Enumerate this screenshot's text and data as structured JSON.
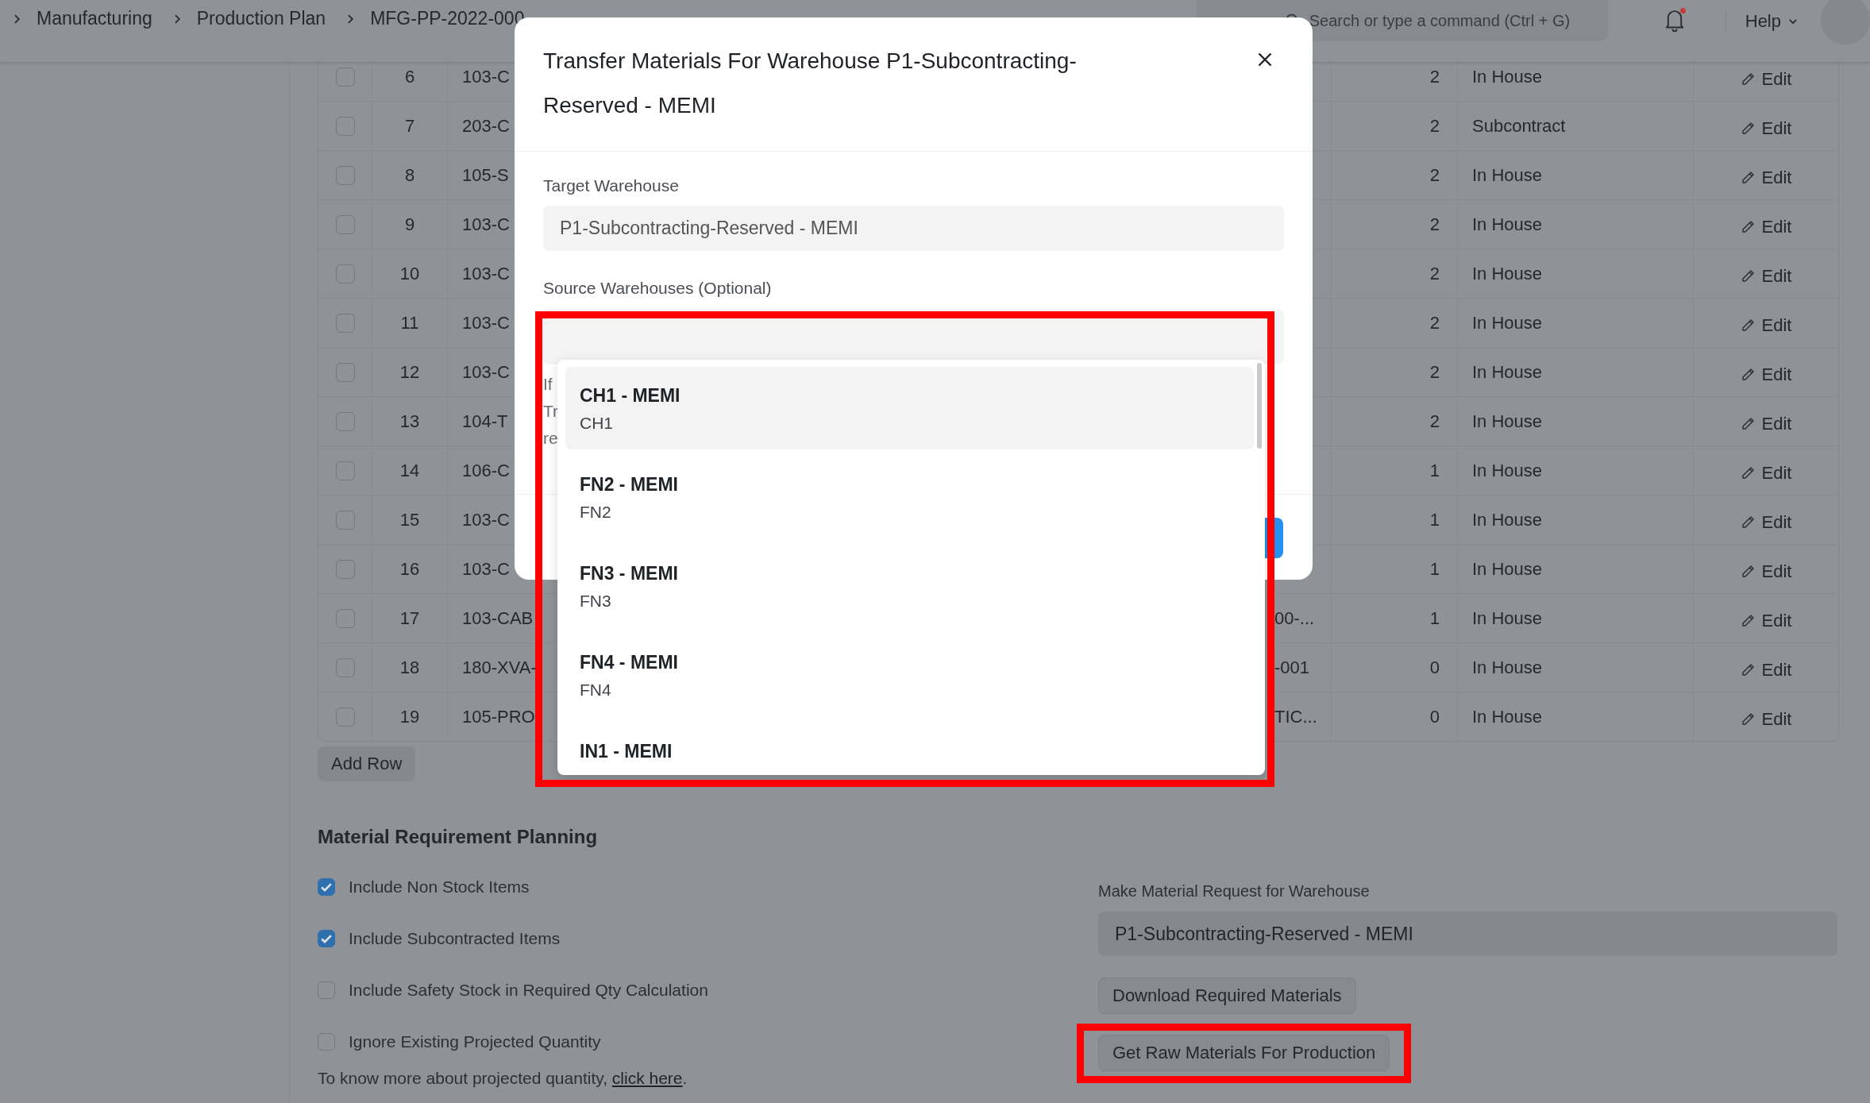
{
  "breadcrumbs": [
    {
      "label": "Manufacturing"
    },
    {
      "label": "Production Plan"
    },
    {
      "label": "MFG-PP-2022-000"
    }
  ],
  "search": {
    "placeholder": "Search or type a command (Ctrl + G)"
  },
  "notifications": {
    "unread": true
  },
  "help_menu": {
    "label": "Help"
  },
  "table": {
    "rows": [
      {
        "selected": false,
        "no": "6",
        "column_3": "103-C",
        "qty": "2",
        "type": "In House",
        "action": "Edit"
      },
      {
        "selected": false,
        "no": "7",
        "column_3": "203-C",
        "qty": "2",
        "type": "Subcontract",
        "action": "Edit"
      },
      {
        "selected": false,
        "no": "8",
        "column_3": "105-S",
        "qty": "2",
        "type": "In House",
        "action": "Edit"
      },
      {
        "selected": false,
        "no": "9",
        "column_3": "103-C",
        "qty": "2",
        "type": "In House",
        "action": "Edit"
      },
      {
        "selected": false,
        "no": "10",
        "column_3": "103-C",
        "qty": "2",
        "type": "In House",
        "action": "Edit"
      },
      {
        "selected": false,
        "no": "11",
        "column_3": "103-C",
        "qty": "2",
        "type": "In House",
        "action": "Edit"
      },
      {
        "selected": false,
        "no": "12",
        "column_3": "103-C",
        "qty": "2",
        "type": "In House",
        "action": "Edit"
      },
      {
        "selected": false,
        "no": "13",
        "column_3": "104-T",
        "qty": "2",
        "type": "In House",
        "action": "Edit"
      },
      {
        "selected": false,
        "no": "14",
        "column_3": "106-C",
        "qty": "1",
        "type": "In House",
        "action": "Edit"
      },
      {
        "selected": false,
        "no": "15",
        "column_3": "103-C",
        "qty": "1",
        "type": "In House",
        "action": "Edit"
      },
      {
        "selected": false,
        "no": "16",
        "column_3": "103-C",
        "qty": "1",
        "type": "In House",
        "action": "Edit"
      },
      {
        "selected": false,
        "no": "17",
        "column_3": "103-CAB",
        "column_4": "00-...",
        "qty": "1",
        "type": "In House",
        "action": "Edit"
      },
      {
        "selected": false,
        "no": "18",
        "column_3": "180-XVA-",
        "column_4": "-001",
        "qty": "0",
        "type": "In House",
        "action": "Edit"
      },
      {
        "selected": false,
        "no": "19",
        "column_3": "105-PRO",
        "column_4": "TIC...",
        "qty": "0",
        "type": "In House",
        "action": "Edit"
      }
    ]
  },
  "add_row_button": "Add Row",
  "mrp": {
    "title": "Material Requirement Planning",
    "options": [
      {
        "label": "Include Non Stock Items",
        "checked": true
      },
      {
        "label": "Include Subcontracted Items",
        "checked": true
      },
      {
        "label": "Include Safety Stock in Required Qty Calculation",
        "checked": false
      },
      {
        "label": "Ignore Existing Projected Quantity",
        "checked": false
      }
    ],
    "note": {
      "text": "To know more about projected quantity,",
      "link": "click here",
      "end": "."
    }
  },
  "material_request": {
    "label": "Make Material Request for Warehouse",
    "value": "P1-Subcontracting-Reserved - MEMI"
  },
  "buttons": [
    {
      "label": "Download Required Materials",
      "highlighted": false
    },
    {
      "label": "Get Raw Materials For Production",
      "highlighted": true
    }
  ],
  "dialog": {
    "title": "Transfer Materials For Warehouse P1-Subcontracting-Reserved - MEMI",
    "target_warehouse": {
      "label": "Target Warehouse",
      "value": "P1-Subcontracting-Reserved - MEMI"
    },
    "source_warehouses": {
      "label": "Source Warehouses (Optional)",
      "highlighted": true,
      "help_lines": [
        "If",
        "Tr",
        "re"
      ],
      "options": [
        {
          "title": "CH1 - MEMI",
          "subtitle": "CH1",
          "selected": true
        },
        {
          "title": "FN2 - MEMI",
          "subtitle": "FN2",
          "selected": false
        },
        {
          "title": "FN3 - MEMI",
          "subtitle": "FN3",
          "selected": false
        },
        {
          "title": "FN4 - MEMI",
          "subtitle": "FN4",
          "selected": false
        },
        {
          "title": "IN1 - MEMI",
          "selected": false
        }
      ]
    }
  }
}
